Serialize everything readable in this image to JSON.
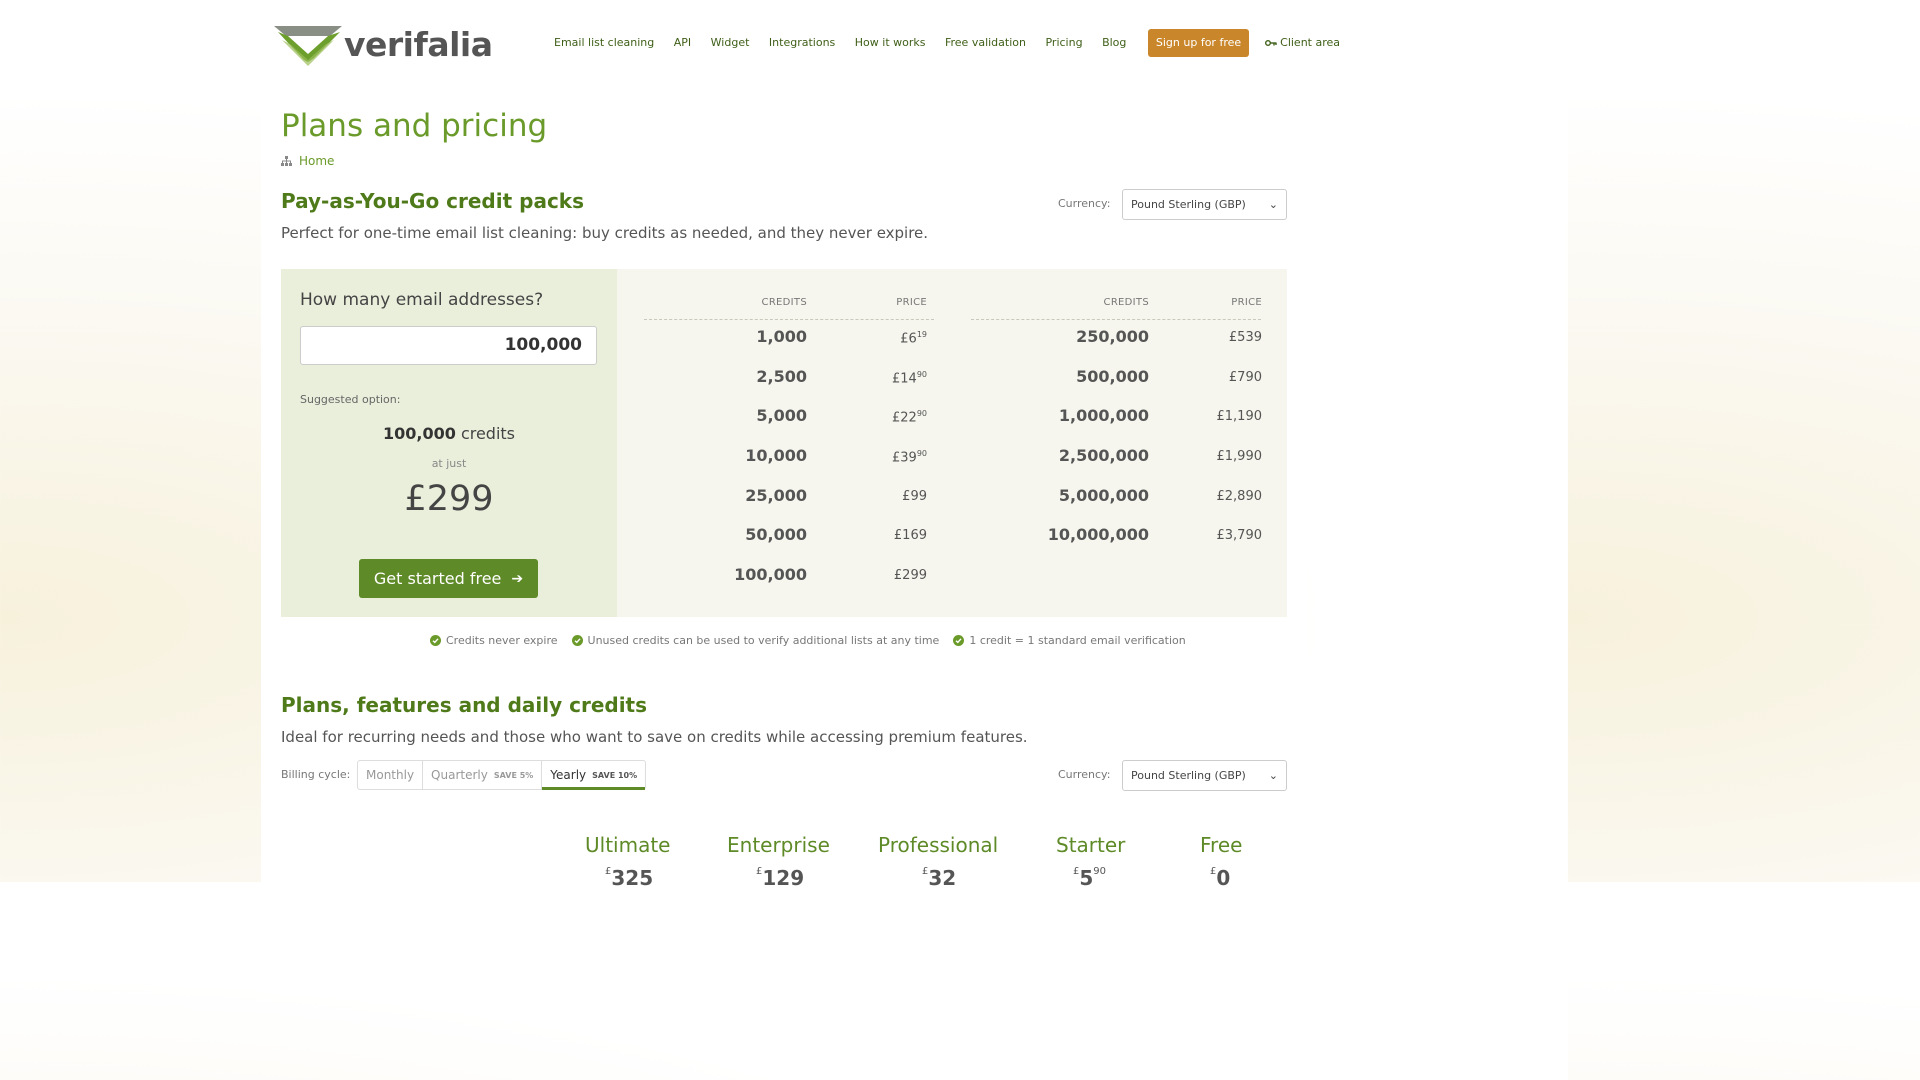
{
  "brand": {
    "name": "verifalia"
  },
  "nav": {
    "items": [
      "Email list cleaning",
      "API",
      "Widget",
      "Integrations",
      "How it works",
      "Free validation",
      "Pricing",
      "Blog"
    ],
    "signup": "Sign up for free",
    "client_area": "Client area"
  },
  "page": {
    "title": "Plans and pricing",
    "breadcrumb": "Home"
  },
  "payg": {
    "heading": "Pay-as-You-Go credit packs",
    "lead": "Perfect for one-time email list cleaning: buy credits as needed, and they never expire.",
    "currency_label": "Currency:",
    "currency_value": "Pound Sterling (GBP)",
    "question": "How many email addresses?",
    "input_value": "100,000",
    "suggested_label": "Suggested option:",
    "suggested_credits": "100,000",
    "credits_word": "credits",
    "at_just": "at just",
    "suggested_price": "£299",
    "cta": "Get started free",
    "col_credits": "CREDITS",
    "col_price": "PRICE",
    "table_left": [
      {
        "credits": "1,000",
        "price": "£6",
        "cents": "19"
      },
      {
        "credits": "2,500",
        "price": "£14",
        "cents": "90"
      },
      {
        "credits": "5,000",
        "price": "£22",
        "cents": "90"
      },
      {
        "credits": "10,000",
        "price": "£39",
        "cents": "90"
      },
      {
        "credits": "25,000",
        "price": "£99",
        "cents": ""
      },
      {
        "credits": "50,000",
        "price": "£169",
        "cents": ""
      },
      {
        "credits": "100,000",
        "price": "£299",
        "cents": ""
      }
    ],
    "table_right": [
      {
        "credits": "250,000",
        "price": "£539",
        "cents": ""
      },
      {
        "credits": "500,000",
        "price": "£790",
        "cents": ""
      },
      {
        "credits": "1,000,000",
        "price": "£1,190",
        "cents": ""
      },
      {
        "credits": "2,500,000",
        "price": "£1,990",
        "cents": ""
      },
      {
        "credits": "5,000,000",
        "price": "£2,890",
        "cents": ""
      },
      {
        "credits": "10,000,000",
        "price": "£3,790",
        "cents": ""
      }
    ],
    "bullets": [
      "Credits never expire",
      "Unused credits can be used to verify additional lists at any time",
      "1 credit = 1 standard email verification"
    ]
  },
  "plans": {
    "heading": "Plans, features and daily credits",
    "lead": "Ideal for recurring needs and those who want to save on credits while accessing premium features.",
    "billing_label": "Billing cycle:",
    "billing_options": [
      {
        "label": "Monthly",
        "save": ""
      },
      {
        "label": "Quarterly",
        "save": "SAVE 5%"
      },
      {
        "label": "Yearly",
        "save": "SAVE 10%"
      }
    ],
    "selected_billing": "Yearly",
    "currency_label": "Currency:",
    "currency_value": "Pound Sterling (GBP)",
    "tiers": [
      {
        "name": "Ultimate",
        "price": "325",
        "cents": ""
      },
      {
        "name": "Enterprise",
        "price": "129",
        "cents": ""
      },
      {
        "name": "Professional",
        "price": "32",
        "cents": ""
      },
      {
        "name": "Starter",
        "price": "5",
        "cents": "90"
      },
      {
        "name": "Free",
        "price": "0",
        "cents": ""
      }
    ],
    "currency_symbol": "£"
  },
  "colors": {
    "accent": "#5e8a27",
    "title": "#6a9a2a",
    "signup": "#c9862a"
  }
}
